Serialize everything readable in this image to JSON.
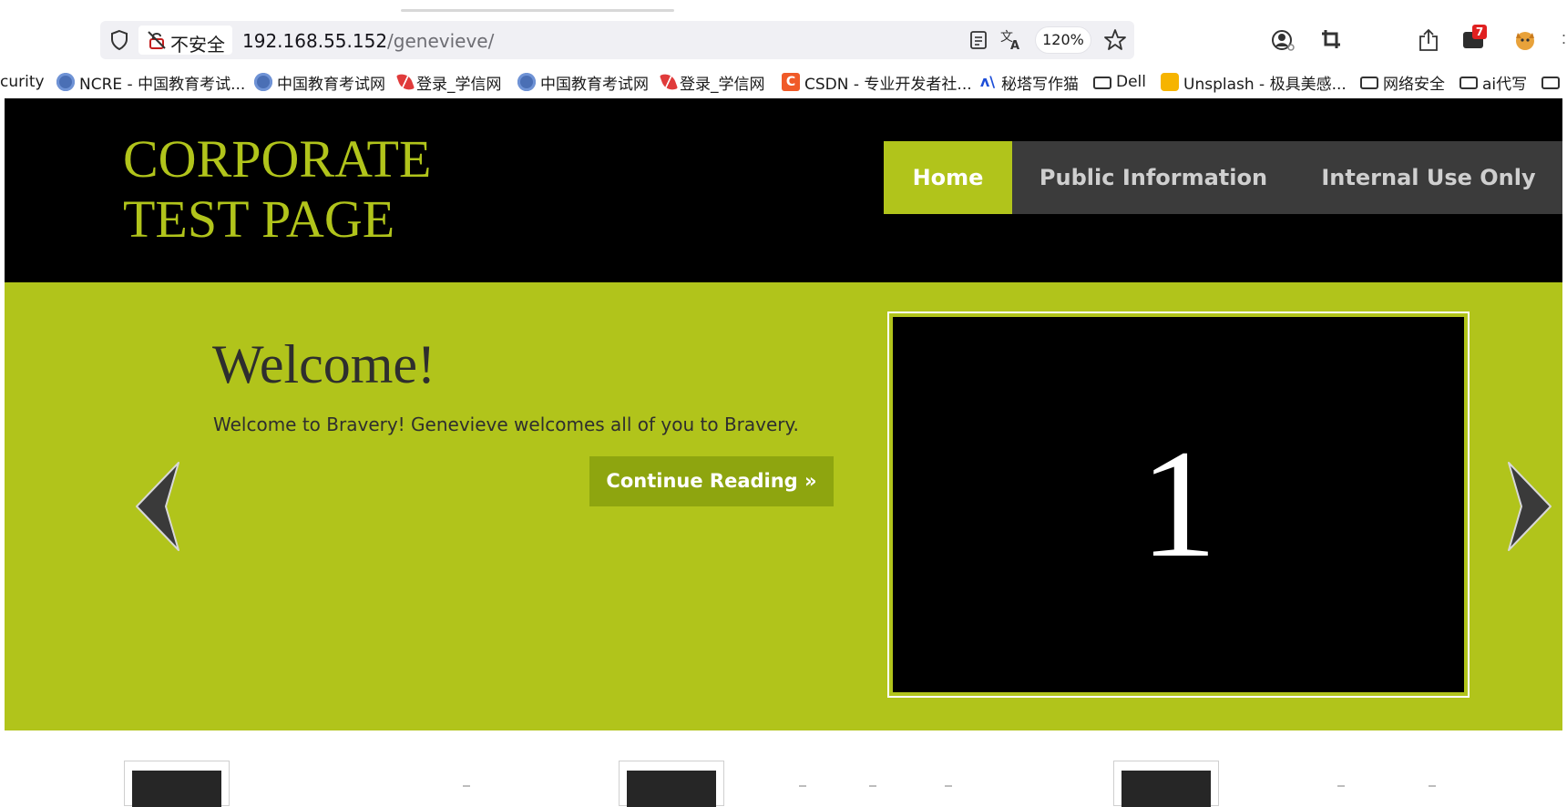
{
  "browser": {
    "security_label": "不安全",
    "url_host": "192.168.55.152",
    "url_path": "/genevieve/",
    "zoom": "120%",
    "extension_badge": "7",
    "bookmarks": [
      {
        "label": "curity",
        "icon": "none"
      },
      {
        "label": "NCRE - 中国教育考试...",
        "icon": "globe-icon"
      },
      {
        "label": "中国教育考试网",
        "icon": "globe-icon"
      },
      {
        "label": "登录_学信网",
        "icon": "feather-icon"
      },
      {
        "label": "中国教育考试网",
        "icon": "globe-icon"
      },
      {
        "label": "登录_学信网",
        "icon": "feather-icon"
      },
      {
        "label": "CSDN - 专业开发者社...",
        "icon": "csdn-icon",
        "icon_text": "C"
      },
      {
        "label": "秘塔写作猫",
        "icon": "mita-icon",
        "icon_text": "ʌ\\"
      },
      {
        "label": "Dell",
        "icon": "folder-icon"
      },
      {
        "label": "Unsplash - 极具美感...",
        "icon": "unsplash-icon"
      },
      {
        "label": "网络安全",
        "icon": "folder-icon"
      },
      {
        "label": "ai代写",
        "icon": "folder-icon"
      }
    ]
  },
  "site": {
    "title_line1": "CORPORATE",
    "title_line2": "TEST PAGE",
    "nav": {
      "home": "Home",
      "public": "Public Information",
      "internal": "Internal Use Only"
    },
    "hero": {
      "heading": "Welcome!",
      "text": "Welcome to Bravery! Genevieve welcomes all of you to Bravery.",
      "button": "Continue Reading »",
      "slide_number": "1"
    }
  },
  "colors": {
    "accent": "#b1c41b",
    "button": "#8ea50f",
    "header_bg": "#000000",
    "nav_bg": "#3b3b3b",
    "text_dark": "#2e2e2e"
  }
}
